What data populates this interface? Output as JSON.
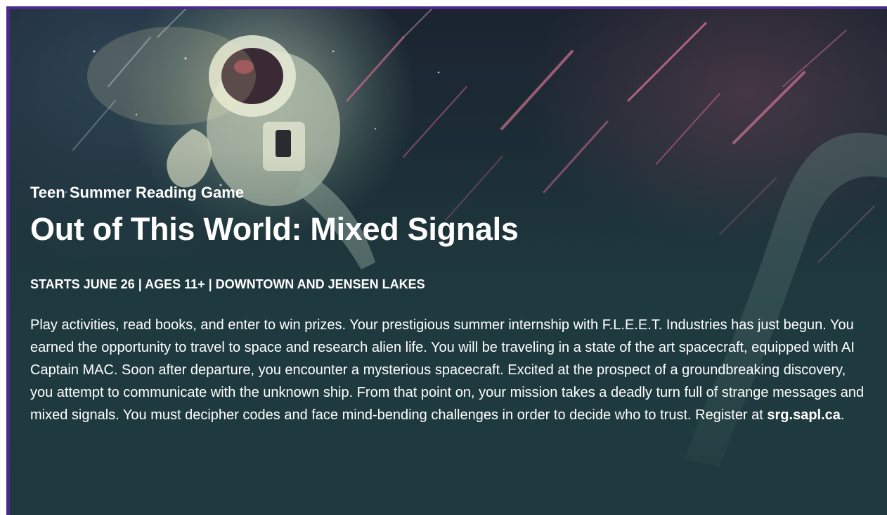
{
  "banner": {
    "eyebrow": "Teen Summer Reading Game",
    "title": "Out of This World: Mixed Signals",
    "meta": "STARTS JUNE 26 | AGES 11+ | DOWNTOWN AND JENSEN LAKES",
    "description": "Play activities, read books, and enter to win prizes. Your prestigious summer internship with F.L.E.E.T. Industries has just begun. You earned the opportunity to travel to space and research alien life. You will be traveling in a state of the art spacecraft, equipped with AI Captain MAC. Soon after departure, you encounter a mysterious spacecraft. Excited at the prospect of a groundbreaking discovery, you attempt to communicate with the unknown ship. From that point on, your mission takes a deadly turn full of strange messages and mixed signals. You must decipher codes and face mind-bending challenges in order to decide who to trust. Register at ",
    "link_text": "srg.sapl.ca",
    "description_end": "."
  },
  "colors": {
    "border": "#4a2a8c",
    "text": "#ffffff",
    "background": "#1f3b40"
  },
  "icons": {
    "artwork": "astronaut-illustration"
  }
}
